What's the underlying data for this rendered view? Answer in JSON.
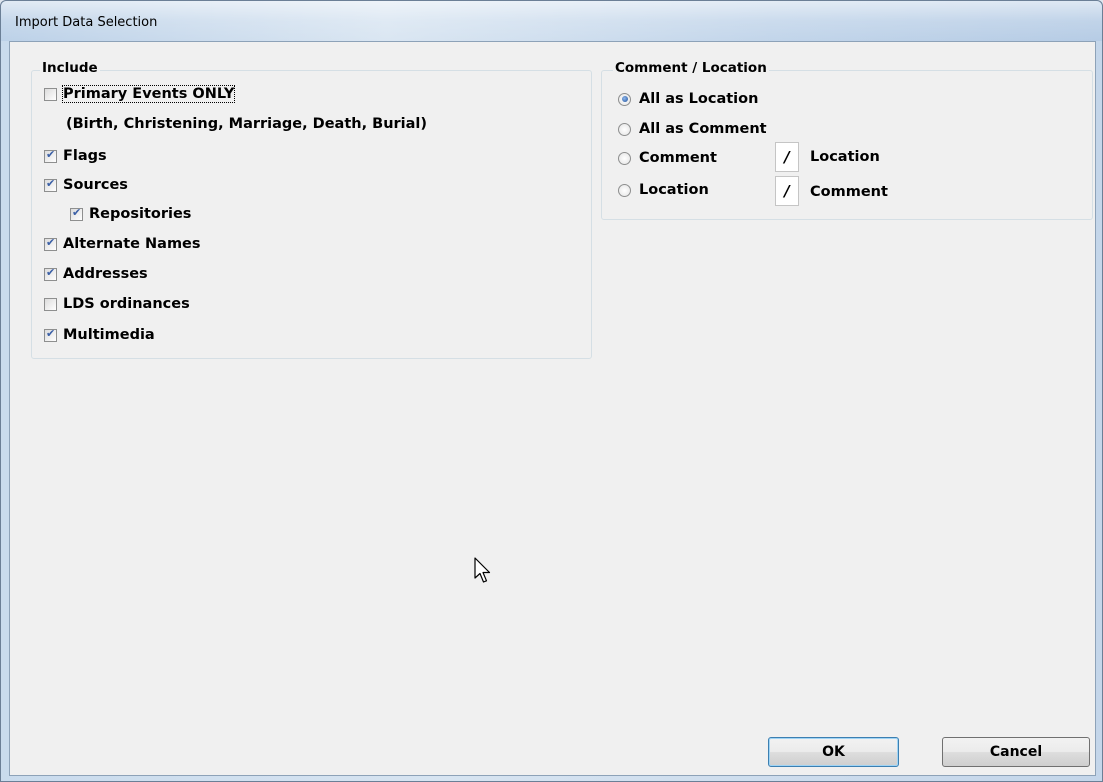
{
  "window": {
    "title": "Import Data Selection"
  },
  "include": {
    "label": "Include",
    "primary_events": {
      "label": "Primary Events ONLY",
      "checked": false
    },
    "primary_events_note": "(Birth, Christening, Marriage, Death, Burial)",
    "options": [
      {
        "label": "Flags",
        "checked": true
      },
      {
        "label": "Sources",
        "checked": true
      },
      {
        "label": "Repositories",
        "checked": true
      },
      {
        "label": "Alternate Names",
        "checked": true
      },
      {
        "label": "Addresses",
        "checked": true
      },
      {
        "label": "LDS ordinances",
        "checked": false
      },
      {
        "label": "Multimedia",
        "checked": true
      }
    ]
  },
  "comment_location": {
    "label": "Comment / Location",
    "options": [
      {
        "label": "All as Location",
        "selected": true
      },
      {
        "label": "All as Comment",
        "selected": false
      },
      {
        "label": "Comment",
        "selected": false,
        "separator": "/",
        "second": "Location"
      },
      {
        "label": "Location",
        "selected": false,
        "separator": "/",
        "second": "Comment"
      }
    ]
  },
  "buttons": {
    "ok": "OK",
    "cancel": "Cancel"
  }
}
